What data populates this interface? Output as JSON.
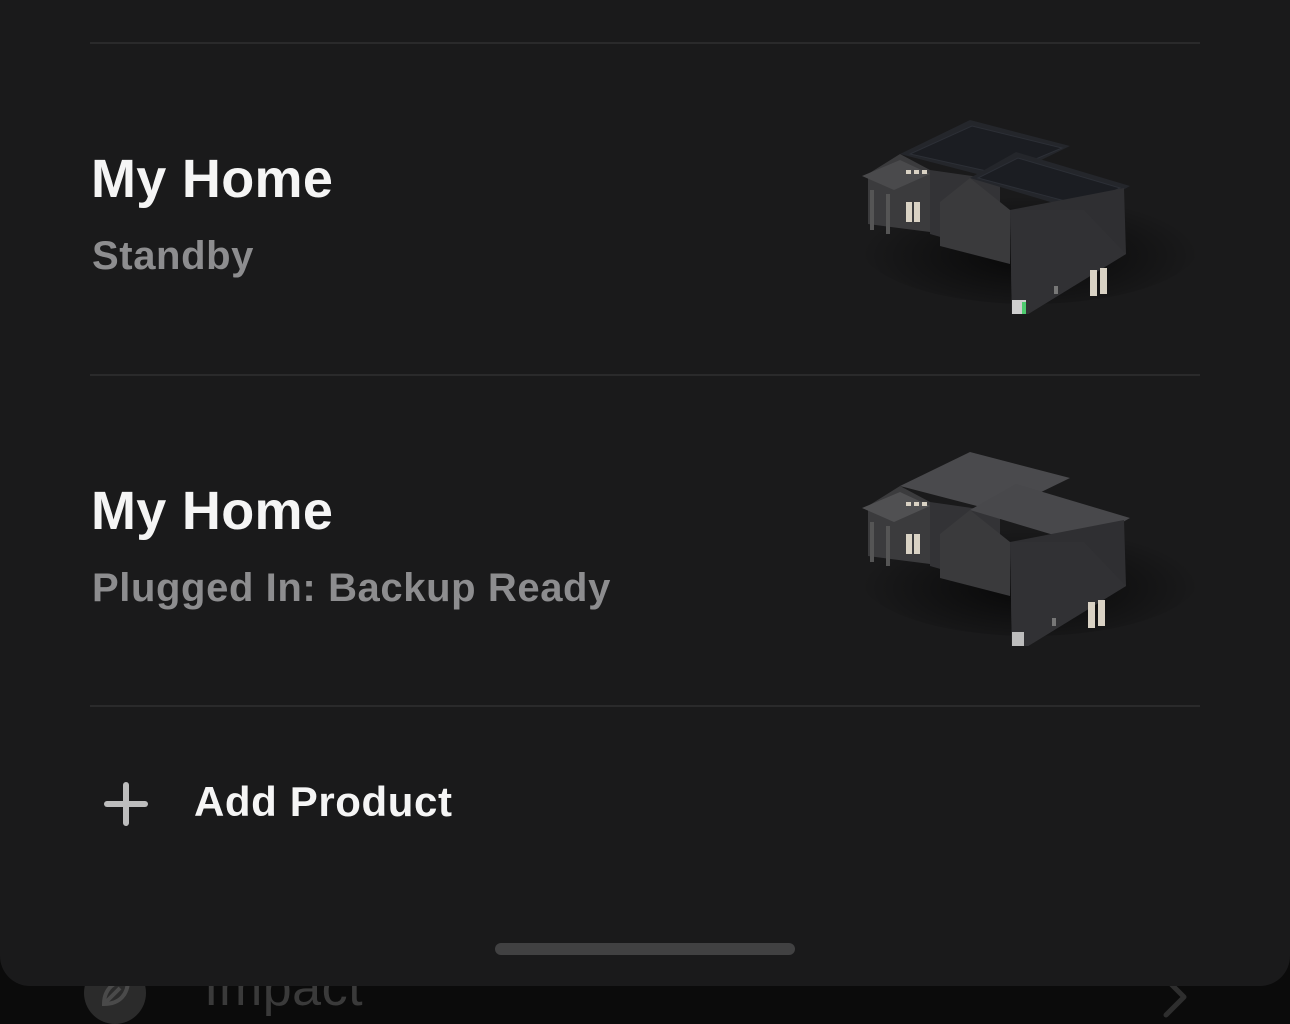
{
  "background": {
    "label": "Impact",
    "leaf_icon": "leaf-icon",
    "chevron_icon": "chevron-right-icon"
  },
  "products": [
    {
      "title": "My Home",
      "status": "Standby",
      "image": "house-with-solar-roof-icon"
    },
    {
      "title": "My Home",
      "status": "Plugged In: Backup Ready",
      "image": "house-icon"
    }
  ],
  "add_product": {
    "label": "Add Product",
    "icon": "plus-icon"
  },
  "colors": {
    "sheet": "#1a1a1b",
    "title": "#f5f5f5",
    "status": "#8d8d8f",
    "divider": "#2a2a2b"
  }
}
